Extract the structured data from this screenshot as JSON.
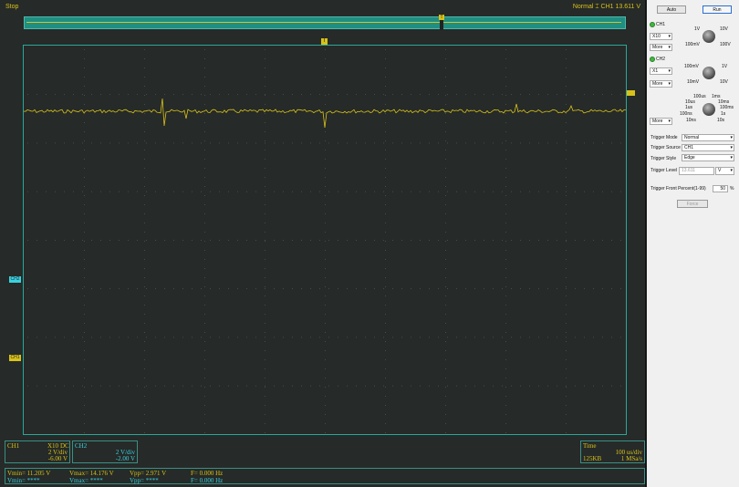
{
  "status": {
    "run_state": "Stop",
    "trigger_text": "Normal",
    "trigger_icon": "trigger-icon",
    "channel": "CH1",
    "level": "13.611 V"
  },
  "markers": {
    "trigger_position": "T",
    "ch2": "CH2",
    "ch1": "CH1"
  },
  "ch1_box": {
    "name": "CH1",
    "probe": "X10",
    "coupling": "DC",
    "scale": "2 V/div",
    "offset": "-6.00 V"
  },
  "ch2_box": {
    "name": "CH2",
    "scale": "2 V/div",
    "offset": "-2.00 V"
  },
  "time_box": {
    "title": "Time",
    "scale": "100 us/div",
    "memory": "125KB",
    "rate": "1 MSa/s"
  },
  "measurements": {
    "vmin1": "Vmin= 11.205 V",
    "vmax1": "Vmax= 14.176 V",
    "vpp1": "Vpp= 2.971 V",
    "f1": "F= 0.000 Hz",
    "vmin2": "Vmin= ****",
    "vmax2": "Vmax= ****",
    "vpp2": "Vpp= ****",
    "f2": "F= 0.000 Hz"
  },
  "panel": {
    "auto": "Auto",
    "run": "Run",
    "ch1": {
      "label": "CH1",
      "probe": "X10",
      "more": "More",
      "k1": "1V",
      "k2": "10V",
      "k3": "100mV",
      "k4": "100V"
    },
    "ch2": {
      "label": "CH2",
      "probe": "X1",
      "more": "More",
      "k1": "100mV",
      "k2": "1V",
      "k3": "10mV",
      "k4": "10V"
    },
    "time": {
      "more": "More",
      "t1": "100us",
      "t2": "1ms",
      "t3": "10us",
      "t4": "10ms",
      "t5": "1us",
      "t6": "100ms",
      "t7": "100ns",
      "t8": "1s",
      "t9": "10ns",
      "t10": "10s"
    },
    "trigger_mode_label": "Trigger Mode",
    "trigger_mode": "Normal",
    "trigger_source_label": "Trigger Source",
    "trigger_source": "CH1",
    "trigger_style_label": "Trigger Style",
    "trigger_style": "Edge",
    "trigger_level_label": "Trigger Level",
    "trigger_level": "13.611",
    "trigger_level_unit": "V",
    "front_percent_label": "Trigger Front Percent(1-99)",
    "front_percent": "50",
    "percent_sign": "%",
    "force": "Force"
  },
  "colors": {
    "ch1": "#d8c21a",
    "ch2": "#3ad1e0",
    "grid": "#29a89a"
  }
}
